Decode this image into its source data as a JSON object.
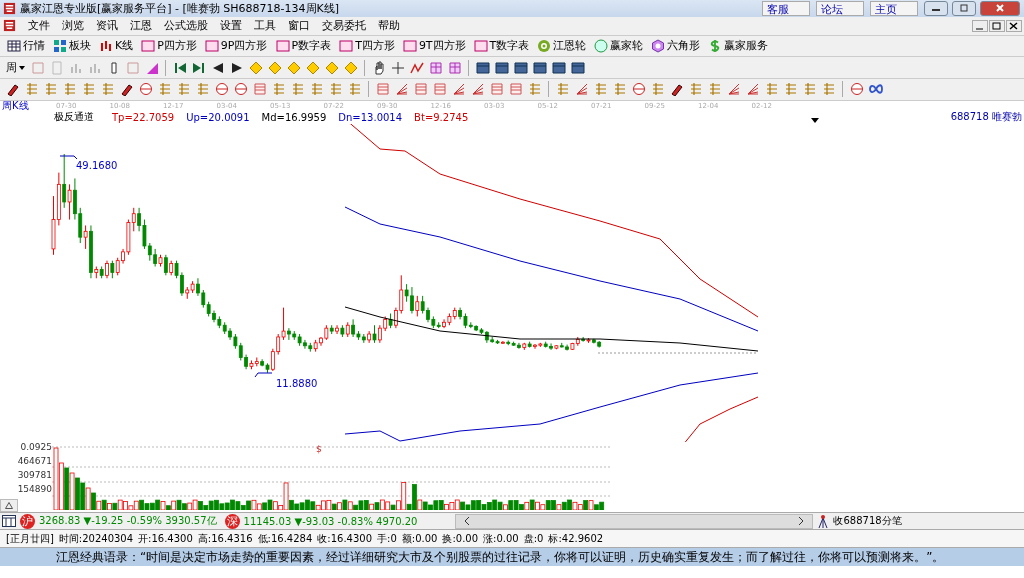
{
  "window": {
    "title": "赢家江恩专业版[赢家服务平台] - [唯赛勃  SH688718-134周K线]",
    "links": [
      "客服",
      "论坛",
      "主页"
    ]
  },
  "menu": [
    "文件",
    "浏览",
    "资讯",
    "江恩",
    "公式选股",
    "设置",
    "工具",
    "窗口",
    "交易委托",
    "帮助"
  ],
  "toolbar": [
    {
      "label": "行情",
      "kind": "grid"
    },
    {
      "label": "板块",
      "kind": "blocks"
    },
    {
      "label": "K线",
      "kind": "candles"
    },
    {
      "label": "P四方形",
      "kind": "square"
    },
    {
      "label": "9P四方形",
      "kind": "square"
    },
    {
      "label": "P数字表",
      "kind": "square"
    },
    {
      "label": "T四方形",
      "kind": "square"
    },
    {
      "label": "9T四方形",
      "kind": "square"
    },
    {
      "label": "T数字表",
      "kind": "square"
    },
    {
      "label": "江恩轮",
      "kind": "target"
    },
    {
      "label": "赢家轮",
      "kind": "circle"
    },
    {
      "label": "六角形",
      "kind": "hexagon"
    },
    {
      "label": "赢家服务",
      "kind": "dollar"
    }
  ],
  "period_dropdown": "周",
  "chart": {
    "period_label": "周K线",
    "dates": [
      "07-30",
      "10-08",
      "12-17",
      "03-04",
      "05-13",
      "07-22",
      "09-30",
      "12-16",
      "03-03",
      "05-12",
      "07-21",
      "09-25",
      "12-04",
      "02-12"
    ],
    "indicator": {
      "name": "极反通道",
      "values": [
        {
          "text": "Tp=22.7059",
          "color": "#d00000"
        },
        {
          "text": "Up=20.0091",
          "color": "#0000c0"
        },
        {
          "text": "Md=16.9959",
          "color": "#000000"
        },
        {
          "text": "Dn=13.0014",
          "color": "#0000c0"
        },
        {
          "text": "Bt=9.2745",
          "color": "#d00000"
        }
      ]
    },
    "stock": "688718  唯赛勃",
    "high_label": "49.1680",
    "low_label": "11.8880",
    "chart_data": {
      "type": "candlestick",
      "ohlc": [
        [
          33,
          42,
          32,
          38
        ],
        [
          38,
          46,
          37,
          44
        ],
        [
          44,
          49.168,
          40,
          41
        ],
        [
          41,
          44,
          38,
          43
        ],
        [
          43,
          45,
          38,
          39
        ],
        [
          39,
          40,
          34,
          35
        ],
        [
          35,
          37,
          33,
          36
        ],
        [
          36,
          37,
          28,
          29
        ],
        [
          29,
          30,
          28,
          29.5
        ],
        [
          29.5,
          30,
          28,
          28.5
        ],
        [
          28.5,
          31,
          28,
          30.5
        ],
        [
          30.5,
          31,
          28,
          29
        ],
        [
          29,
          31.5,
          28.5,
          31
        ],
        [
          31,
          33,
          30.5,
          32.5
        ],
        [
          32.5,
          38,
          32,
          37.5
        ],
        [
          37.5,
          40,
          36,
          39
        ],
        [
          39,
          40,
          36,
          37
        ],
        [
          37,
          38,
          33,
          33.5
        ],
        [
          33.5,
          34,
          31,
          32
        ],
        [
          32,
          33,
          30,
          30.5
        ],
        [
          30.5,
          32,
          30,
          31.5
        ],
        [
          31.5,
          32,
          28.5,
          29
        ],
        [
          29,
          31,
          28.5,
          30.5
        ],
        [
          30.5,
          31,
          28,
          28.5
        ],
        [
          28.5,
          29,
          25,
          25.5
        ],
        [
          25.5,
          26.5,
          24.5,
          26
        ],
        [
          26,
          27.5,
          25.5,
          27
        ],
        [
          27,
          28,
          25,
          25.5
        ],
        [
          25.5,
          26,
          23,
          23.5
        ],
        [
          23.5,
          24,
          21.5,
          22
        ],
        [
          22,
          22.5,
          20.5,
          21
        ],
        [
          21,
          21.5,
          19.5,
          20
        ],
        [
          20,
          20.5,
          18.5,
          19
        ],
        [
          19,
          19.5,
          17.5,
          18
        ],
        [
          18,
          18.5,
          16,
          16.5
        ],
        [
          16.5,
          17,
          14,
          14.5
        ],
        [
          14.5,
          15,
          12.5,
          13
        ],
        [
          13,
          14,
          12.5,
          13.5
        ],
        [
          13.5,
          14.5,
          13,
          13.8
        ],
        [
          13.8,
          14.2,
          13,
          13.2
        ],
        [
          13.2,
          13.5,
          11.888,
          12.5
        ],
        [
          12.5,
          16,
          12.2,
          15.5
        ],
        [
          15.5,
          18.5,
          15,
          18
        ],
        [
          18,
          23,
          17.5,
          19
        ],
        [
          19,
          19.5,
          17.5,
          18.5
        ],
        [
          18.5,
          19,
          17.5,
          18
        ],
        [
          18,
          18.5,
          16.5,
          17
        ],
        [
          17,
          17.5,
          16,
          16.5
        ],
        [
          16.5,
          17,
          15.5,
          16
        ],
        [
          16,
          17.5,
          15.5,
          17
        ],
        [
          17,
          18,
          16.5,
          17.8
        ],
        [
          17.8,
          20,
          17.5,
          19.5
        ],
        [
          19.5,
          20,
          18.5,
          19
        ],
        [
          19,
          20,
          18.5,
          19.5
        ],
        [
          19.5,
          20,
          18,
          18.5
        ],
        [
          18.5,
          20.5,
          18,
          20
        ],
        [
          20,
          21,
          18,
          18.5
        ],
        [
          18.5,
          19,
          17.5,
          18
        ],
        [
          18,
          18.5,
          17,
          17.5
        ],
        [
          17.5,
          19,
          17,
          18.5
        ],
        [
          18.5,
          20,
          17,
          17.5
        ],
        [
          17.5,
          20,
          17,
          19.5
        ],
        [
          19.5,
          21.5,
          19,
          21
        ],
        [
          21,
          22,
          19.5,
          20
        ],
        [
          20,
          23,
          19.5,
          22.5
        ],
        [
          22.5,
          28.5,
          22,
          26
        ],
        [
          26,
          27,
          24,
          25
        ],
        [
          25,
          26.5,
          22,
          22.5
        ],
        [
          22.5,
          25,
          21.5,
          24
        ],
        [
          24,
          25,
          22,
          22.5
        ],
        [
          22.5,
          23,
          20.5,
          21
        ],
        [
          21,
          21.5,
          19.5,
          20
        ],
        [
          20,
          20.5,
          19.5,
          19.8
        ],
        [
          19.8,
          21,
          19.5,
          20.5
        ],
        [
          20.5,
          22,
          20,
          21.5
        ],
        [
          21.5,
          23,
          21,
          22.5
        ],
        [
          22.5,
          23,
          21,
          21.5
        ],
        [
          21.5,
          22,
          19.5,
          20
        ],
        [
          20,
          20.5,
          19.5,
          19.8
        ],
        [
          19.8,
          20,
          19,
          19.2
        ],
        [
          19.2,
          19.5,
          18.5,
          18.8
        ],
        [
          18.8,
          19,
          17,
          17.5
        ],
        [
          17.5,
          18,
          17,
          17.2
        ],
        [
          17.2,
          17.5,
          16.8,
          17
        ],
        [
          17,
          17.3,
          16.8,
          17.1
        ],
        [
          17.1,
          17.4,
          16.6,
          16.9
        ],
        [
          16.9,
          17.2,
          16.5,
          16.6
        ],
        [
          16.6,
          17,
          16,
          16.2
        ],
        [
          16.2,
          17,
          15.8,
          16.8
        ],
        [
          16.8,
          17.2,
          16.2,
          16.4
        ],
        [
          16.4,
          16.8,
          16,
          16.6
        ],
        [
          16.6,
          17,
          16.3,
          16.8
        ],
        [
          16.8,
          17.2,
          16.2,
          16.4
        ],
        [
          16.4,
          16.9,
          15.8,
          16.1
        ],
        [
          16.1,
          16.6,
          15.9,
          16.5
        ],
        [
          16.5,
          17,
          16.2,
          16.3
        ],
        [
          16.3,
          16.7,
          15.7,
          15.9
        ],
        [
          15.9,
          17,
          15.8,
          16.9
        ],
        [
          16.9,
          18,
          16.5,
          17.6
        ],
        [
          17.6,
          18,
          17.2,
          17.4
        ],
        [
          17.4,
          17.8,
          17,
          17.5
        ],
        [
          17.5,
          17.7,
          16.9,
          17.1
        ],
        [
          17.1,
          17.3,
          16.2,
          16.43
        ]
      ]
    }
  },
  "volume": {
    "top_label": "0.0925",
    "ticks": [
      "464671",
      "309781",
      "154890"
    ],
    "marker": "$"
  },
  "indices": [
    {
      "badge": "沪",
      "value": "3268.83 ▼-19.25 -0.59% 3930.57亿"
    },
    {
      "badge": "深",
      "value": "11145.03 ▼-93.03 -0.83% 4970.20"
    }
  ],
  "feed": "收688718分笔",
  "info": [
    "[正月廿四]",
    "时间:20240304",
    "开:16.4300",
    "高:16.4316",
    "低:16.4284",
    "收:16.4300",
    "手:0",
    "额:0.00",
    "换:0.00",
    "涨:0.00",
    "盘:0",
    "标:42.9602"
  ],
  "quote": "江恩经典语录：“时间是决定市场走势的重要因素，经过详细研究大市及个别股票的过往记录，你将可以证明，历史确实重复发生；而了解过往，你将可以预测将来。”。"
}
